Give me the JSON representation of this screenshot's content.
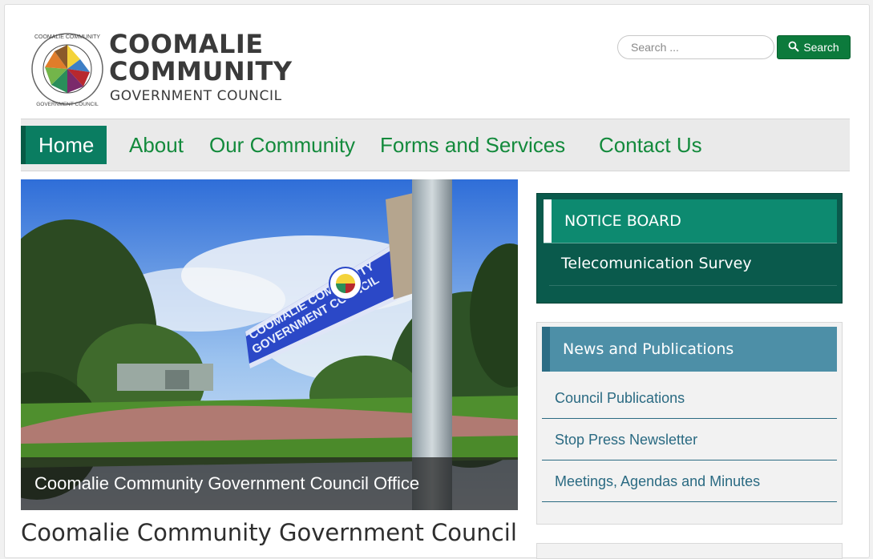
{
  "header": {
    "brand_line1": "COOMALIE",
    "brand_line2": "COMMUNITY",
    "brand_line3": "GOVERNMENT COUNCIL",
    "logo_ring_top": "COOMALIE COMMUNITY",
    "logo_ring_bottom": "GOVERNMENT COUNCIL"
  },
  "search": {
    "placeholder": "Search ...",
    "value": "",
    "button_label": "Search",
    "button_icon": "search-icon"
  },
  "nav": {
    "items": [
      {
        "label": "Home",
        "active": true
      },
      {
        "label": "About",
        "active": false
      },
      {
        "label": "Our Community",
        "active": false
      },
      {
        "label": "Forms and Services",
        "active": false
      },
      {
        "label": "Contact Us",
        "active": false
      }
    ]
  },
  "hero": {
    "caption": "Coomalie Community Government Council Office",
    "sign_text_line1": "COOMALIE COMMUNITY",
    "sign_text_line2": "GOVERNMENT COUNCIL"
  },
  "main": {
    "title": "Coomalie Community Government Council"
  },
  "notice_board": {
    "title": "NOTICE BOARD",
    "items": [
      "Telecomunication Survey"
    ]
  },
  "news": {
    "title": "News and Publications",
    "items": [
      "Council Publications",
      "Stop Press Newsletter",
      "Meetings, Agendas and Minutes"
    ]
  },
  "colors": {
    "nav_active": "#0a7d61",
    "nav_text": "#138a3c",
    "search_button": "#0c7a3c",
    "notice_bg": "#0a5a4c",
    "notice_head": "#0d8a70",
    "news_head": "#4d8fa7",
    "news_link": "#2a6a82"
  }
}
